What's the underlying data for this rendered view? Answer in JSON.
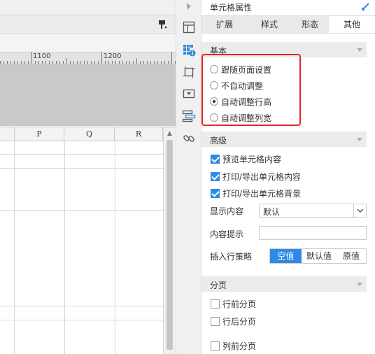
{
  "editor": {
    "ruler_marks": [
      "1100",
      "1200"
    ],
    "columns": [
      "P",
      "Q",
      "R"
    ]
  },
  "panel": {
    "title": "单元格属性",
    "tabs": [
      {
        "label": "扩展",
        "active": false
      },
      {
        "label": "样式",
        "active": false
      },
      {
        "label": "形态",
        "active": false
      },
      {
        "label": "其他",
        "active": true
      }
    ],
    "basic": {
      "title": "基本",
      "options": [
        {
          "label": "跟随页面设置",
          "checked": false
        },
        {
          "label": "不自动调整",
          "checked": false
        },
        {
          "label": "自动调整行高",
          "checked": true
        },
        {
          "label": "自动调整列宽",
          "checked": false
        }
      ]
    },
    "advanced": {
      "title": "高级",
      "checkboxes": [
        {
          "label": "预览单元格内容",
          "checked": true
        },
        {
          "label": "打印/导出单元格内容",
          "checked": true
        },
        {
          "label": "打印/导出单元格背景",
          "checked": true
        }
      ],
      "display_label": "显示内容",
      "display_value": "默认",
      "tip_label": "内容提示",
      "tip_value": "",
      "insert_label": "插入行策略",
      "insert_options": [
        {
          "label": "空值",
          "active": true
        },
        {
          "label": "默认值",
          "active": false
        },
        {
          "label": "原值",
          "active": false
        }
      ]
    },
    "pagination": {
      "title": "分页",
      "checkboxes": [
        {
          "label": "行前分页",
          "checked": false
        },
        {
          "label": "行后分页",
          "checked": false
        },
        {
          "label": "列前分页",
          "checked": false
        }
      ]
    }
  },
  "colors": {
    "accent": "#2f8ae5",
    "highlight": "#e3262b"
  },
  "icons": [
    "collapse-arrow-icon",
    "layout-icon",
    "cell-info-icon",
    "border-icon",
    "widget-icon",
    "condition-icon",
    "hyperlink-icon",
    "pin-icon",
    "format-brush-icon"
  ]
}
